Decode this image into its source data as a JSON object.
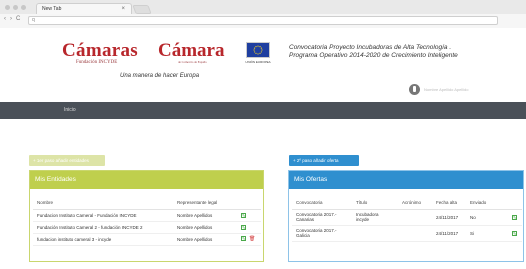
{
  "browser": {
    "tab_title": "New Tab",
    "tab_close": "×",
    "back": "‹",
    "forward": "›",
    "reload": "C",
    "url": "q"
  },
  "header": {
    "logo1_name": "Cámaras",
    "logo1_sub": "Fundación INCYDE",
    "logo2_name": "Cámara",
    "logo2_sub": "de Comercio de España",
    "slogan": "Una manera de hacer Europa",
    "eu_label": "UNIÓN EUROPEA",
    "conv_title_line1": "Convocatoria Proyecto Incubadoras de Alta Tecnología .",
    "conv_title_line2": "Programa Operativo 2014-2020 de Crecimiento Inteligente",
    "user_name": "Nombre Apellido Apellido"
  },
  "menu": {
    "inicio": "Inicio"
  },
  "left": {
    "button": "+ 1er paso añadir entidades",
    "title": "Mis Entidades",
    "columns": [
      "Nombre",
      "Representante legal"
    ],
    "rows": [
      {
        "nombre": "Fundacion Instituto Cameral - Fundación INCYDE",
        "rep": "Nombre Apellidos",
        "deletable": false
      },
      {
        "nombre": "Fundación Instituto Cameral 2 - fundación INCYDE 2",
        "rep": "Nombre Apellidos",
        "deletable": false
      },
      {
        "nombre": "fundacion instituto cameral 3 - incyde",
        "rep": "Nombre Apellidos",
        "deletable": true
      }
    ]
  },
  "right": {
    "button": "+ 2º paso añadir oferta",
    "title": "Mis Ofertas",
    "columns": [
      "Convocatoria",
      "Título",
      "Acrónimo",
      "Fecha alta",
      "Enviado"
    ],
    "rows": [
      {
        "conv_l1": "Convocatoria 2017.-",
        "conv_l2": "Canarias",
        "titulo_l1": "Incubadora",
        "titulo_l2": "incyde",
        "acronimo": "",
        "fecha": "24/11/2017",
        "enviado": "No"
      },
      {
        "conv_l1": "Convocatoria 2017.-",
        "conv_l2": "Galicia",
        "titulo_l1": "",
        "titulo_l2": "",
        "acronimo": "",
        "fecha": "24/11/2017",
        "enviado": "Si"
      }
    ]
  },
  "colors": {
    "green": "#bfcf4d",
    "blue": "#2f8fcf",
    "brand_red": "#b8272c",
    "menubar": "#4a5058"
  },
  "icons": {
    "edit": "edit-icon",
    "delete": "trash-icon",
    "user": "user-avatar-icon"
  }
}
